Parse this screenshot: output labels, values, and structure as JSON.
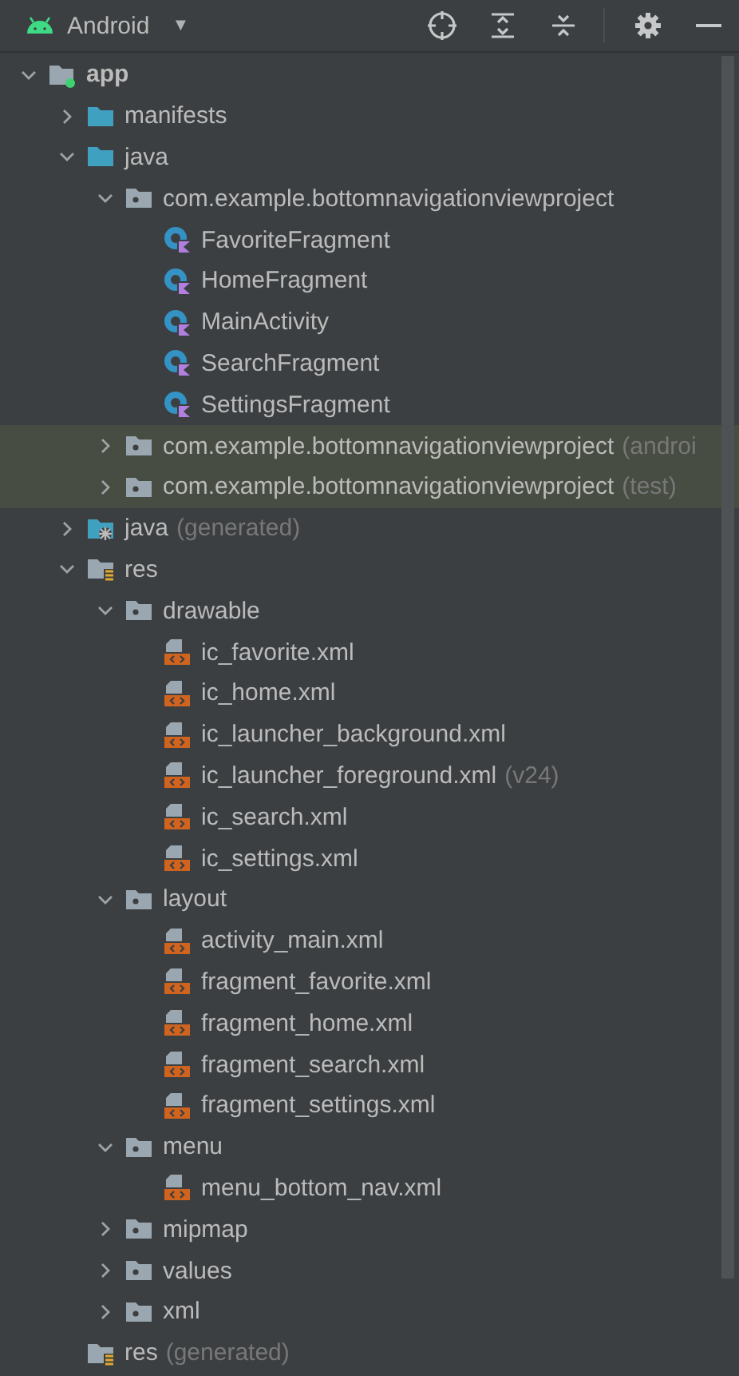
{
  "toolbar": {
    "view": "Android",
    "dropdown": "▼"
  },
  "tree": [
    {
      "label": "app",
      "kind": "module",
      "expanded": true,
      "children": [
        {
          "label": "manifests",
          "kind": "source-folder",
          "expanded": false
        },
        {
          "label": "java",
          "kind": "source-folder",
          "expanded": true,
          "children": [
            {
              "label": "com.example.bottomnavigationviewproject",
              "kind": "package",
              "expanded": true,
              "children": [
                {
                  "label": "FavoriteFragment",
                  "kind": "class"
                },
                {
                  "label": "HomeFragment",
                  "kind": "class"
                },
                {
                  "label": "MainActivity",
                  "kind": "class"
                },
                {
                  "label": "SearchFragment",
                  "kind": "class"
                },
                {
                  "label": "SettingsFragment",
                  "kind": "class"
                }
              ]
            },
            {
              "label": "com.example.bottomnavigationviewproject",
              "suffix": "(androi",
              "kind": "package",
              "expanded": false,
              "highlighted": true
            },
            {
              "label": "com.example.bottomnavigationviewproject",
              "suffix": "(test)",
              "kind": "package",
              "expanded": false,
              "highlighted": true
            }
          ]
        },
        {
          "label": "java",
          "suffix": "(generated)",
          "kind": "generated-folder",
          "expanded": false
        },
        {
          "label": "res",
          "kind": "res-folder",
          "expanded": true,
          "children": [
            {
              "label": "drawable",
              "kind": "package",
              "expanded": true,
              "children": [
                {
                  "label": "ic_favorite.xml",
                  "kind": "xml"
                },
                {
                  "label": "ic_home.xml",
                  "kind": "xml"
                },
                {
                  "label": "ic_launcher_background.xml",
                  "kind": "xml"
                },
                {
                  "label": "ic_launcher_foreground.xml",
                  "suffix": "(v24)",
                  "kind": "xml"
                },
                {
                  "label": "ic_search.xml",
                  "kind": "xml"
                },
                {
                  "label": "ic_settings.xml",
                  "kind": "xml"
                }
              ]
            },
            {
              "label": "layout",
              "kind": "package",
              "expanded": true,
              "children": [
                {
                  "label": "activity_main.xml",
                  "kind": "xml"
                },
                {
                  "label": "fragment_favorite.xml",
                  "kind": "xml"
                },
                {
                  "label": "fragment_home.xml",
                  "kind": "xml"
                },
                {
                  "label": "fragment_search.xml",
                  "kind": "xml"
                },
                {
                  "label": "fragment_settings.xml",
                  "kind": "xml"
                }
              ]
            },
            {
              "label": "menu",
              "kind": "package",
              "expanded": true,
              "children": [
                {
                  "label": "menu_bottom_nav.xml",
                  "kind": "xml"
                }
              ]
            },
            {
              "label": "mipmap",
              "kind": "package",
              "expanded": false
            },
            {
              "label": "values",
              "kind": "package",
              "expanded": false
            },
            {
              "label": "xml",
              "kind": "package",
              "expanded": false
            }
          ]
        },
        {
          "label": "res",
          "suffix": "(generated)",
          "kind": "res-folder"
        }
      ]
    }
  ]
}
